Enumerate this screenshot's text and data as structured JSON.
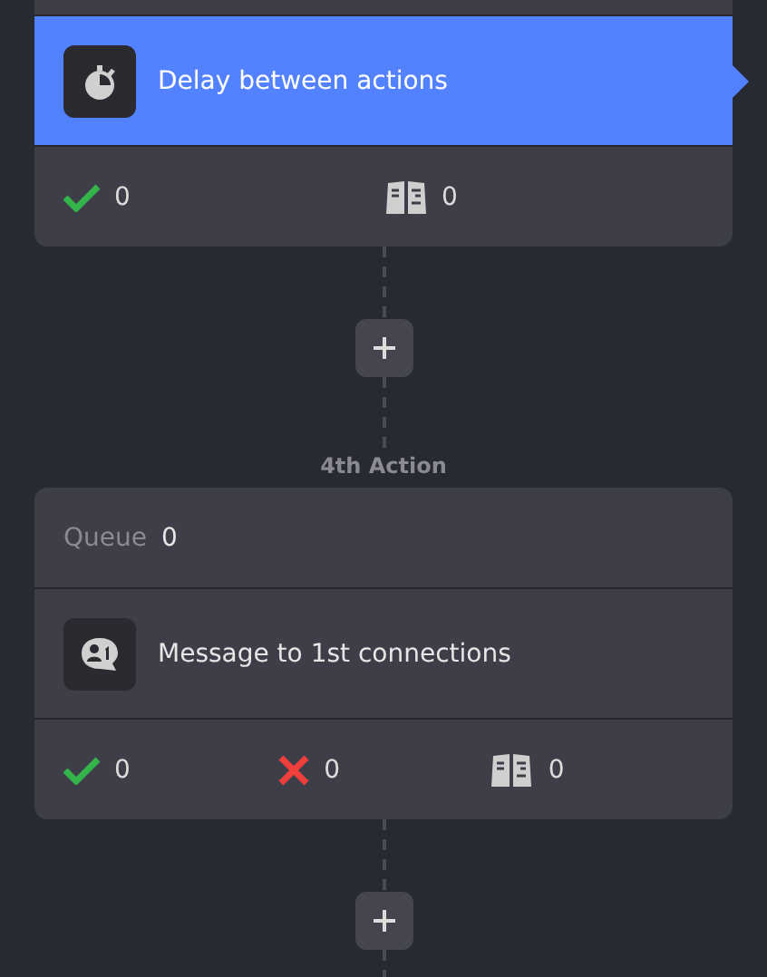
{
  "cards": [
    {
      "action": {
        "title": "Delay between actions",
        "kind": "timer",
        "selected": true
      },
      "stats": [
        {
          "kind": "success",
          "value": "0"
        },
        {
          "kind": "skipped",
          "value": "0"
        }
      ]
    },
    {
      "label": "4th Action",
      "queue": {
        "label": "Queue",
        "value": "0"
      },
      "action": {
        "title": "Message to 1st connections",
        "kind": "message",
        "selected": false
      },
      "stats": [
        {
          "kind": "success",
          "value": "0"
        },
        {
          "kind": "failed",
          "value": "0"
        },
        {
          "kind": "skipped",
          "value": "0"
        }
      ]
    }
  ]
}
